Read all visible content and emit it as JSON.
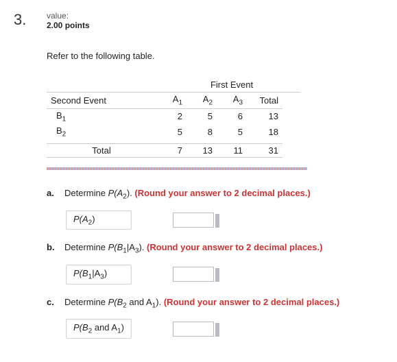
{
  "question_number": "3.",
  "value_label": "value:",
  "value_points": "2.00 points",
  "refer_text": "Refer to the following table.",
  "table": {
    "top_header": "First Event",
    "row_header": "Second Event",
    "cols": [
      "A",
      "A",
      "A",
      "Total"
    ],
    "col_subs": [
      "1",
      "2",
      "3",
      ""
    ],
    "rows": [
      {
        "label": "B",
        "sub": "1",
        "vals": [
          "2",
          "5",
          "6",
          "13"
        ]
      },
      {
        "label": "B",
        "sub": "2",
        "vals": [
          "5",
          "8",
          "5",
          "18"
        ]
      }
    ],
    "total_label": "Total",
    "totals": [
      "7",
      "13",
      "11",
      "31"
    ]
  },
  "parts": [
    {
      "letter": "a.",
      "prompt_pre": "Determine ",
      "prob": "P(A",
      "sub": "2",
      "post": "). ",
      "instr": "(Round your answer to 2 decimal places.)",
      "label_pre": "P(A",
      "label_sub": "2",
      "label_post": ")"
    },
    {
      "letter": "b.",
      "prompt_pre": "Determine ",
      "prob": "P(B",
      "sub": "1",
      "mid": "|A",
      "sub2": "3",
      "post": "). ",
      "instr": "(Round your answer to 2 decimal places.)",
      "label_pre": "P(B",
      "label_sub": "1",
      "label_mid": "|A",
      "label_sub2": "3",
      "label_post": ")"
    },
    {
      "letter": "c.",
      "prompt_pre": "Determine ",
      "prob": "P(B",
      "sub": "2",
      "mid": " and A",
      "sub2": "1",
      "post": "). ",
      "instr": "(Round your answer to 2 decimal places.)",
      "label_pre": "P(B",
      "label_sub": "2",
      "label_mid": " and A",
      "label_sub2": "1",
      "label_post": ")"
    }
  ]
}
